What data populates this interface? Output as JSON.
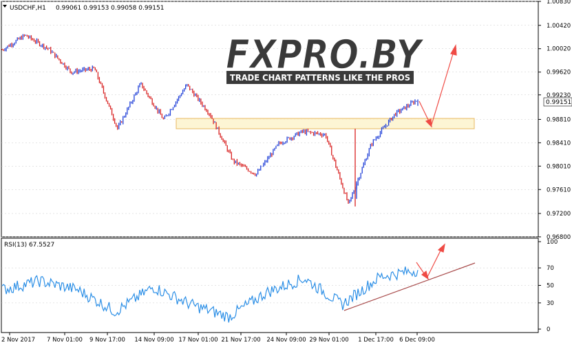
{
  "main_panel": {
    "symbol_label": "USDCHF,H1",
    "ohlc_label": "0.99061 0.99153 0.99058 0.99151",
    "current_price_label": "0.99151",
    "y_ticks": [
      "1.00830",
      "1.00420",
      "1.00020",
      "0.99620",
      "0.99230",
      "0.98810",
      "0.98410",
      "0.98010",
      "0.97610",
      "0.97200",
      "0.96800"
    ]
  },
  "rsi_panel": {
    "label": "RSI(13) 67.5527",
    "y_ticks": [
      "100",
      "70",
      "50",
      "30",
      "0"
    ]
  },
  "x_ticks": [
    "2 Nov 2017",
    "7 Nov 01:00",
    "9 Nov 17:00",
    "14 Nov 09:00",
    "17 Nov 01:00",
    "21 Nov 17:00",
    "24 Nov 09:00",
    "29 Nov 01:00",
    "1 Dec 17:00",
    "6 Dec 09:00"
  ],
  "watermark": {
    "logo_text": "FXPRO.BY",
    "tagline": "TRADE CHART PATTERNS LIKE THE PROS"
  },
  "colors": {
    "bull": "#1f3fd8",
    "bear": "#d81f1f",
    "rsi_line": "#2a8ee6",
    "zone_fill": "#fdf3cc",
    "zone_border": "#e8b860",
    "arrow": "#ef4b45",
    "trendline": "#a84a4a",
    "grid": "#c8c8c8"
  },
  "chart_data": [
    {
      "type": "candlestick",
      "title": "USDCHF,H1",
      "ylim": [
        0.968,
        1.0083
      ],
      "last_ohlc": {
        "open": 0.99061,
        "high": 0.99153,
        "low": 0.99058,
        "close": 0.99151
      },
      "key_points": [
        {
          "x": "2 Nov 2017",
          "price": 1.0
        },
        {
          "x": "3 Nov",
          "price": 1.0025
        },
        {
          "x": "7 Nov 01:00",
          "price": 1.0002
        },
        {
          "x": "9 Nov 17:00",
          "price": 0.9962
        },
        {
          "x": "13 Nov",
          "price": 0.9968
        },
        {
          "x": "14 Nov 09:00",
          "price": 0.9865
        },
        {
          "x": "16 Nov",
          "price": 0.9942
        },
        {
          "x": "17 Nov 01:00",
          "price": 0.988
        },
        {
          "x": "20 Nov",
          "price": 0.994
        },
        {
          "x": "21 Nov 17:00",
          "price": 0.989
        },
        {
          "x": "22 Nov",
          "price": 0.981
        },
        {
          "x": "24 Nov 09:00",
          "price": 0.9787
        },
        {
          "x": "28 Nov",
          "price": 0.984
        },
        {
          "x": "29 Nov 01:00",
          "price": 0.986
        },
        {
          "x": "30 Nov",
          "price": 0.9855
        },
        {
          "x": "1 Dec 17:00",
          "price": 0.9735
        },
        {
          "x": "4 Dec",
          "price": 0.984
        },
        {
          "x": "6 Dec 09:00",
          "price": 0.989
        },
        {
          "x": "7 Dec",
          "price": 0.99151
        }
      ],
      "support_zone": [
        0.9877,
        0.9893
      ]
    },
    {
      "type": "line",
      "title": "RSI(13) 67.5527",
      "ylim": [
        0,
        100
      ],
      "levels": [
        70,
        50,
        30
      ],
      "key_points": [
        {
          "x": "2 Nov 2017",
          "value": 45
        },
        {
          "x": "7 Nov 01:00",
          "value": 55
        },
        {
          "x": "9 Nov 17:00",
          "value": 45
        },
        {
          "x": "14 Nov 09:00",
          "value": 20
        },
        {
          "x": "17 Nov 01:00",
          "value": 48
        },
        {
          "x": "21 Nov 17:00",
          "value": 28
        },
        {
          "x": "22 Nov",
          "value": 14
        },
        {
          "x": "24 Nov 09:00",
          "value": 42
        },
        {
          "x": "29 Nov 01:00",
          "value": 58
        },
        {
          "x": "1 Dec 17:00",
          "value": 28
        },
        {
          "x": "6 Dec 09:00",
          "value": 60
        },
        {
          "x": "7 Dec",
          "value": 67.5527
        }
      ]
    }
  ]
}
